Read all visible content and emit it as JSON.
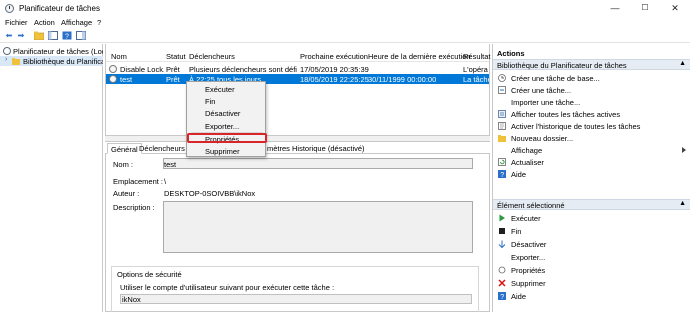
{
  "window": {
    "title": "Planificateur de tâches",
    "minimize": "—",
    "maximize": "☐",
    "close": "✕"
  },
  "menu": [
    "Fichier",
    "Action",
    "Affichage",
    "?"
  ],
  "tree": {
    "root": "Planificateur de tâches (Local)",
    "child": "Bibliothèque du Planificateur"
  },
  "list": {
    "headers": [
      "Nom",
      "Statut",
      "Déclencheurs",
      "Prochaine exécution",
      "Heure de la dernière exécution",
      "Résultat"
    ],
    "rows": [
      {
        "name": "Disable Lock...",
        "status": "Prêt",
        "triggers": "Plusieurs déclencheurs sont définis.",
        "next": "17/05/2019 20:35:39",
        "last": "",
        "result": "L'opéra"
      },
      {
        "name": "test",
        "status": "Prêt",
        "triggers": "À 22:25 tous les jours",
        "next": "18/05/2019 22:25:25",
        "last": "30/11/1999 00:00:00",
        "result": "La tâche"
      }
    ]
  },
  "context_menu": [
    "Exécuter",
    "Fin",
    "Désactiver",
    "Exporter...",
    "Propriétés",
    "Supprimer"
  ],
  "tabs": [
    "Général",
    "Déclencheurs",
    "mètres",
    "Historique (désactivé)"
  ],
  "details": {
    "name_label": "Nom :",
    "name_value": "test",
    "location_label": "Emplacement :",
    "location_value": "\\",
    "author_label": "Auteur :",
    "author_value": "DESKTOP-0SOIVBB\\ikNox",
    "description_label": "Description :",
    "security_title": "Options de sécurité",
    "security_text": "Utiliser le compte d'utilisateur suivant pour exécuter cette tâche :",
    "account": "ikNox"
  },
  "actions": {
    "title": "Actions",
    "section1": "Bibliothèque du Planificateur de tâches",
    "items1": [
      {
        "icon": "create-basic-task-icon",
        "label": "Créer une tâche de base..."
      },
      {
        "icon": "create-task-icon",
        "label": "Créer une tâche..."
      },
      {
        "icon": "",
        "label": "Importer une tâche..."
      },
      {
        "icon": "running-tasks-icon",
        "label": "Afficher toutes les tâches actives"
      },
      {
        "icon": "history-icon",
        "label": "Activer l'historique de toutes les tâches"
      },
      {
        "icon": "new-folder-icon",
        "label": "Nouveau dossier..."
      },
      {
        "icon": "",
        "label": "Affichage"
      },
      {
        "icon": "refresh-icon",
        "label": "Actualiser"
      },
      {
        "icon": "help-icon",
        "label": "Aide"
      }
    ],
    "section2": "Élément sélectionné",
    "items2": [
      {
        "icon": "run-icon",
        "label": "Exécuter"
      },
      {
        "icon": "stop-icon",
        "label": "Fin"
      },
      {
        "icon": "disable-icon",
        "label": "Désactiver"
      },
      {
        "icon": "",
        "label": "Exporter..."
      },
      {
        "icon": "properties-icon",
        "label": "Propriétés"
      },
      {
        "icon": "delete-icon",
        "label": "Supprimer"
      },
      {
        "icon": "help-icon",
        "label": "Aide"
      }
    ]
  },
  "colors": {
    "selection": "#0078d7",
    "highlight_box": "#d9242a",
    "section_bg": "#e6ecf4"
  }
}
